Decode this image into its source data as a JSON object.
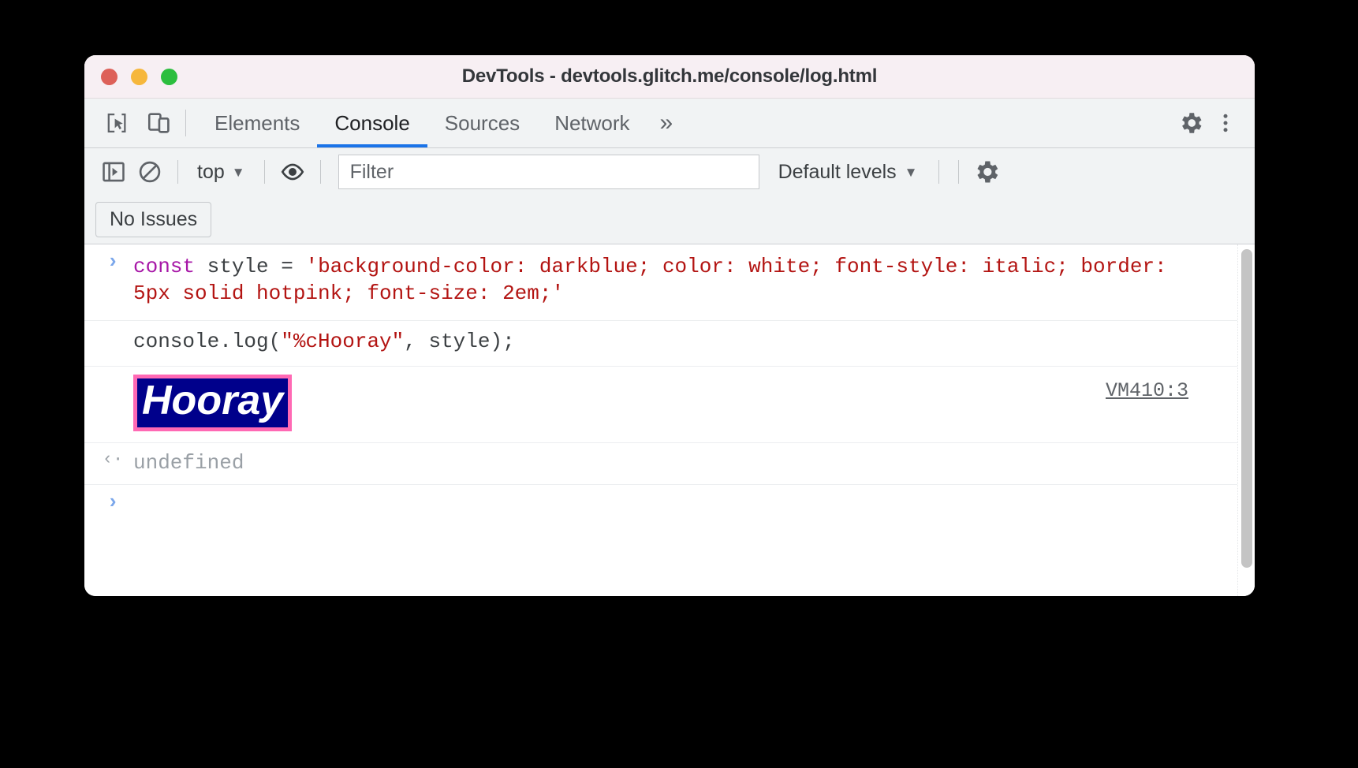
{
  "window": {
    "title": "DevTools - devtools.glitch.me/console/log.html",
    "traffic_lights": [
      "close",
      "minimize",
      "maximize"
    ]
  },
  "tabbar": {
    "inspect_icon": "inspect-cursor-icon",
    "device_icon": "device-toolbar-icon",
    "tabs": [
      {
        "label": "Elements",
        "active": false
      },
      {
        "label": "Console",
        "active": true
      },
      {
        "label": "Sources",
        "active": false
      },
      {
        "label": "Network",
        "active": false
      }
    ],
    "more_label": "»",
    "settings_icon": "gear-icon",
    "menu_icon": "kebab-menu-icon"
  },
  "console_toolbar": {
    "sidebar_icon": "console-sidebar-icon",
    "clear_icon": "clear-console-icon",
    "context": {
      "label": "top",
      "caret": "▼"
    },
    "eye_icon": "live-expression-eye-icon",
    "filter": {
      "value": "",
      "placeholder": "Filter"
    },
    "levels": {
      "label": "Default levels",
      "caret": "▼"
    },
    "settings_icon": "console-settings-gear-icon"
  },
  "issues": {
    "button_label": "No Issues"
  },
  "console": {
    "rows": [
      {
        "type": "input",
        "gutter": "›",
        "tokens": [
          {
            "text": "const ",
            "cls": "tok-kw"
          },
          {
            "text": "style ",
            "cls": "tok-plain"
          },
          {
            "text": "= ",
            "cls": "tok-plain"
          },
          {
            "text": "'background-color: darkblue; color: white; font-style: italic; border: 5px solid hotpink; font-size: 2em;'",
            "cls": "tok-str"
          }
        ],
        "plain": "const style = 'background-color: darkblue; color: white; font-style: italic; border: 5px solid hotpink; font-size: 2em;'"
      },
      {
        "type": "input",
        "gutter": "",
        "tokens": [
          {
            "text": "console.log(",
            "cls": "tok-plain"
          },
          {
            "text": "\"%cHooray\"",
            "cls": "tok-str"
          },
          {
            "text": ", style);",
            "cls": "tok-plain"
          }
        ],
        "plain": "console.log(\"%cHooray\", style);"
      },
      {
        "type": "styled-log",
        "gutter": "",
        "text": "Hooray",
        "source": "VM410:3",
        "style": {
          "background_color": "#00008b",
          "color": "#ffffff",
          "font_style": "italic",
          "border": "5px solid #ff69b4",
          "font_size": "2em"
        }
      },
      {
        "type": "result",
        "gutter": "‹·",
        "text": "undefined"
      },
      {
        "type": "prompt",
        "gutter": "›",
        "text": ""
      }
    ]
  },
  "colors": {
    "accent_blue": "#1a73e8",
    "keyword_purple": "#a717a7",
    "string_red": "#b31412",
    "hotpink": "#ff69b4",
    "darkblue": "#00008b",
    "titlebar_bg": "#f7eff3",
    "toolbar_bg": "#f1f3f4"
  }
}
